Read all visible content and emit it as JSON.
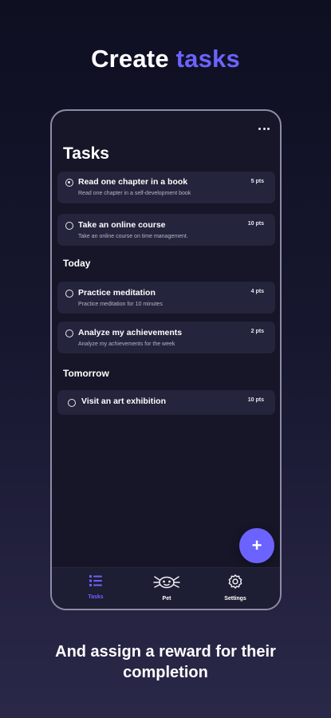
{
  "headline": {
    "prefix": "Create",
    "accent": "tasks"
  },
  "accent_color": "#6c63ff",
  "screen": {
    "title": "Tasks",
    "menu_icon": "more-dots-icon",
    "tasks_undated": [
      {
        "title": "Read one chapter in a book",
        "description": "Read one chapter in a self-development book",
        "points": "5 pts",
        "checked": true
      },
      {
        "title": "Take an online course",
        "description": "Take an online course on time management.",
        "points": "10 pts",
        "checked": false
      }
    ],
    "today_label": "Today",
    "tasks_today": [
      {
        "title": "Practice meditation",
        "description": "Practice meditation for 10 minutes",
        "points": "4 pts",
        "checked": false
      },
      {
        "title": "Analyze my achievements",
        "description": "Analyze my achievements for the week",
        "points": "2 pts",
        "checked": false
      }
    ],
    "tomorrow_label": "Tomorrow",
    "tasks_tomorrow": [
      {
        "title": "Visit an art exhibition",
        "description": "",
        "points": "10 pts",
        "checked": false
      }
    ],
    "fab_label": "+",
    "nav": [
      {
        "label": "Tasks",
        "icon": "task-list-icon",
        "active": true
      },
      {
        "label": "Pet",
        "icon": "axolotl-pet-icon",
        "active": false
      },
      {
        "label": "Settings",
        "icon": "gear-icon",
        "active": false
      }
    ]
  },
  "tagline": {
    "line1": "And assign a reward for their",
    "line2": "completion"
  }
}
